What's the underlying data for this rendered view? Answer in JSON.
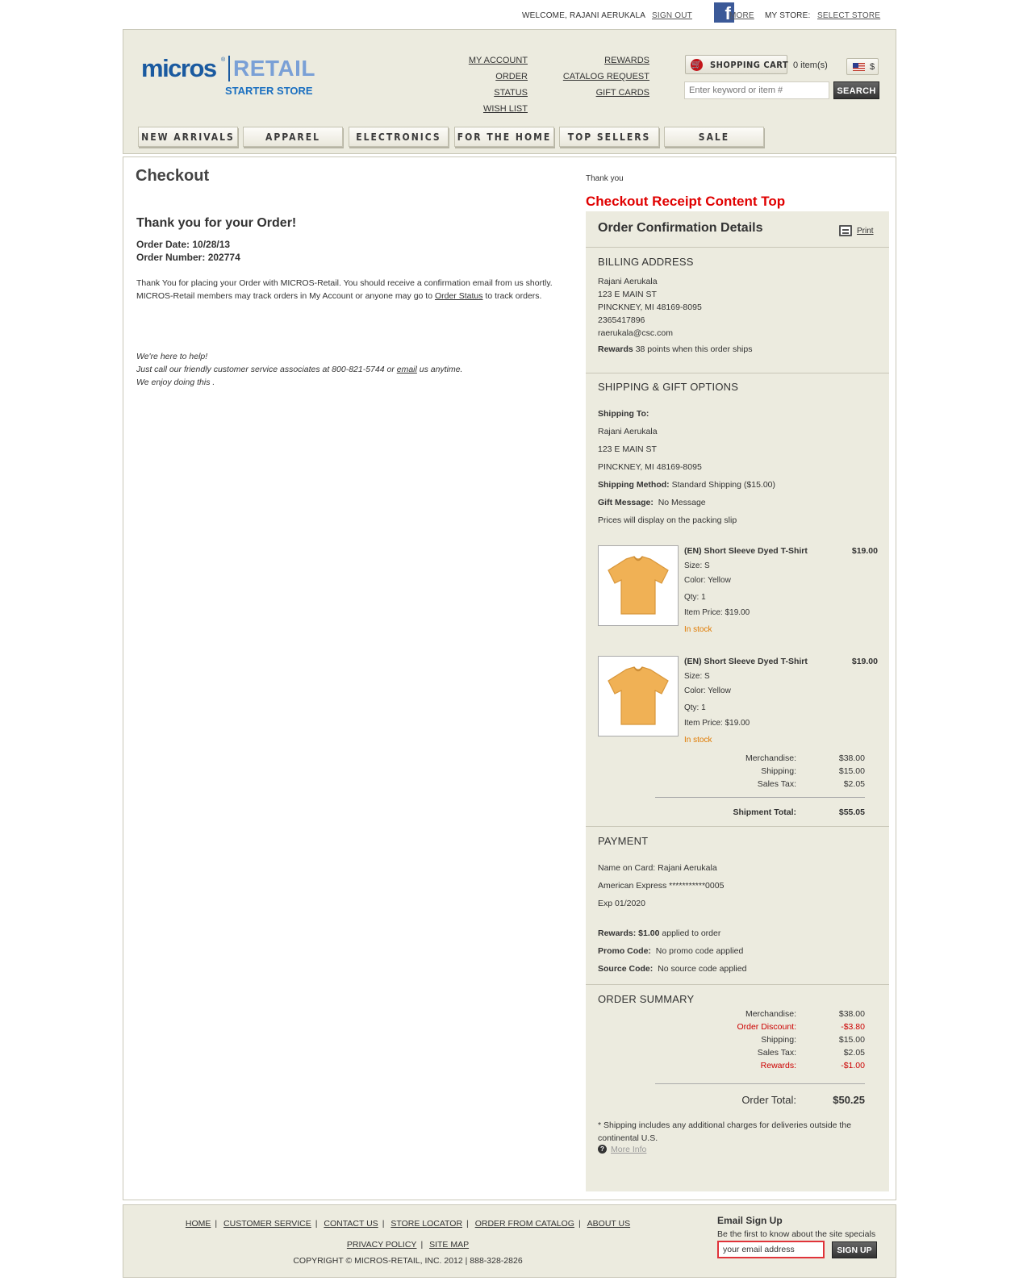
{
  "utility": {
    "welcome": "WELCOME, RAJANI AERUKALA",
    "sign_out": "SIGN OUT",
    "facebook_glyph": "f",
    "more": "MORE",
    "my_store": "MY STORE:",
    "select_store": "SELECT STORE"
  },
  "logo": {
    "micros": "micros",
    "reg": "®",
    "retail": "RETAIL",
    "starter": "STARTER STORE"
  },
  "header_links": {
    "my_account": "MY ACCOUNT",
    "order_status": "ORDER STATUS",
    "wish_list": "WISH LIST",
    "rewards": "REWARDS",
    "catalog_request": "CATALOG REQUEST",
    "gift_cards": "GIFT CARDS"
  },
  "cart": {
    "label": "SHOPPING CART",
    "count": "0 item(s)",
    "currency_symbol": "$"
  },
  "search": {
    "placeholder": "Enter keyword or item #",
    "button": "SEARCH"
  },
  "nav": {
    "tabs": [
      "NEW ARRIVALS",
      "APPAREL",
      "ELECTRONICS",
      "FOR THE HOME",
      "TOP SELLERS",
      "SALE"
    ]
  },
  "main": {
    "title": "Checkout",
    "thanks_heading": "Thank you for your Order!",
    "order_date_label": "Order Date:",
    "order_date": "10/28/13",
    "order_number_label": "Order Number:",
    "order_number": "202774",
    "confirm_line1": "Thank You for placing your Order with MICROS-Retail. You should receive a confirmation email from us shortly.",
    "confirm_line2_pre": "MICROS-Retail members may track orders in My Account or anyone may go to ",
    "confirm_line2_link": "Order Status",
    "confirm_line2_post": " to track orders.",
    "help_line1": "We're here to help!",
    "help_line2_pre": "Just call our friendly customer service associates at 800-821-5744 or ",
    "help_line2_link": "email",
    "help_line2_post": " us anytime.",
    "help_line3": "We enjoy doing this ."
  },
  "receipt": {
    "thank_you_small": "Thank you",
    "content_top_label": "Checkout Receipt Content Top",
    "title": "Order Confirmation Details",
    "print": "Print",
    "billing": {
      "heading": "BILLING ADDRESS",
      "name": "Rajani Aerukala",
      "street": "123 E MAIN ST",
      "city": "PINCKNEY, MI 48169-8095",
      "phone": "2365417896",
      "email": "raerukala@csc.com",
      "rewards_label": "Rewards",
      "rewards_text": "38 points when this order ships"
    },
    "shipping": {
      "heading": "SHIPPING & GIFT OPTIONS",
      "to_label": "Shipping To:",
      "name": "Rajani Aerukala",
      "street": "123 E MAIN ST",
      "city": "PINCKNEY, MI 48169-8095",
      "method_label": "Shipping Method:",
      "method": "Standard Shipping ($15.00)",
      "gift_label": "Gift Message:",
      "gift": "No Message",
      "prices_note": "Prices will display on the packing slip"
    },
    "items": [
      {
        "name": "(EN) Short Sleeve Dyed T-Shirt",
        "price": "$19.00",
        "size": "Size: S",
        "color": "Color: Yellow",
        "qty": "Qty: 1",
        "item_price": "Item Price: $19.00",
        "stock": "In stock"
      },
      {
        "name": "(EN) Short Sleeve Dyed T-Shirt",
        "price": "$19.00",
        "size": "Size: S",
        "color": "Color: Yellow",
        "qty": "Qty: 1",
        "item_price": "Item Price: $19.00",
        "stock": "In stock"
      }
    ],
    "shipment_totals": {
      "merch_label": "Merchandise:",
      "merch": "$38.00",
      "ship_label": "Shipping:",
      "ship": "$15.00",
      "tax_label": "Sales Tax:",
      "tax": "$2.05",
      "total_label": "Shipment Total:",
      "total": "$55.05"
    },
    "payment": {
      "heading": "PAYMENT",
      "name_on_card": "Name on Card: Rajani Aerukala",
      "card": "American Express ***********0005",
      "exp": "Exp 01/2020",
      "rewards_label": "Rewards: $1.00",
      "rewards_text": "applied to order",
      "promo_label": "Promo Code:",
      "promo": "No promo code applied",
      "source_label": "Source Code:",
      "source": "No source code applied"
    },
    "summary": {
      "heading": "ORDER SUMMARY",
      "merch_label": "Merchandise:",
      "merch": "$38.00",
      "discount_label": "Order Discount:",
      "discount": "-$3.80",
      "ship_label": "Shipping:",
      "ship": "$15.00",
      "tax_label": "Sales Tax:",
      "tax": "$2.05",
      "rewards_label": "Rewards:",
      "rewards": "-$1.00",
      "total_label": "Order Total:",
      "total": "$50.25",
      "note": "* Shipping includes any additional charges for deliveries outside the continental U.S.",
      "more_info": "More Info"
    }
  },
  "footer": {
    "links_row1": [
      "HOME",
      "CUSTOMER SERVICE",
      "CONTACT US",
      "STORE LOCATOR",
      "ORDER FROM CATALOG",
      "ABOUT US"
    ],
    "links_row2": [
      "PRIVACY POLICY",
      "SITE MAP"
    ],
    "copyright": "COPYRIGHT © MICROS-RETAIL, INC. 2012 | 888-328-2826",
    "email_title": "Email Sign Up",
    "email_sub": "Be the first to know about the site specials",
    "email_value": "your email address",
    "email_button": "SIGN UP"
  },
  "colors": {
    "header_bg": "#ecebdf",
    "brand_blue": "#1a5aa0",
    "accent_red": "#e00000",
    "stock_orange": "#e07a00"
  }
}
